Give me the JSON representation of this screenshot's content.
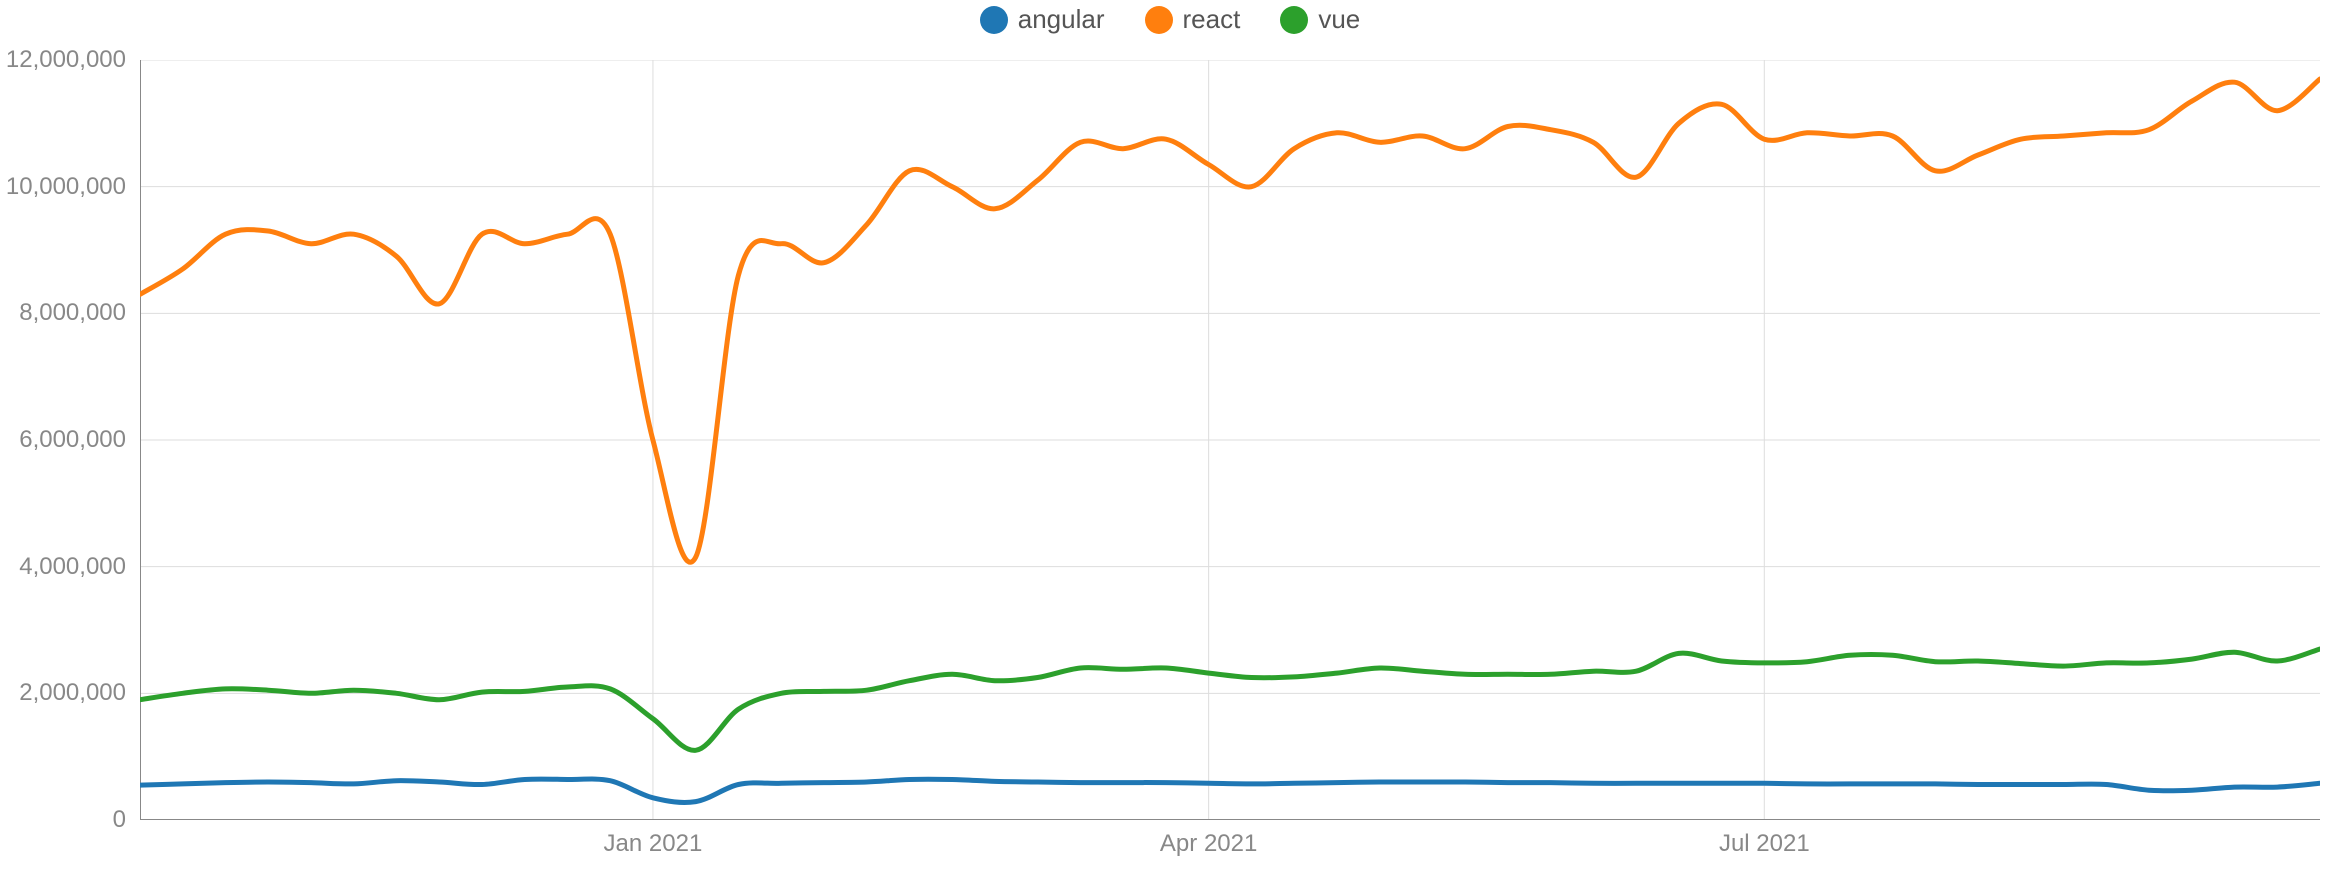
{
  "legend": {
    "items": [
      {
        "name": "angular",
        "label": "angular",
        "color": "#1f77b4"
      },
      {
        "name": "react",
        "label": "react",
        "color": "#ff7f0e"
      },
      {
        "name": "vue",
        "label": "vue",
        "color": "#2ca02c"
      }
    ]
  },
  "chart_data": {
    "type": "line",
    "title": "",
    "xlabel": "",
    "ylabel": "",
    "ylim": [
      0,
      12000000
    ],
    "y_ticks": [
      0,
      2000000,
      4000000,
      6000000,
      8000000,
      10000000,
      12000000
    ],
    "y_tick_labels": [
      "0",
      "2,000,000",
      "4,000,000",
      "6,000,000",
      "8,000,000",
      "10,000,000",
      "12,000,000"
    ],
    "xlim": [
      0,
      51
    ],
    "x_ticks": [
      12,
      25,
      38
    ],
    "x_tick_labels": [
      "Jan 2021",
      "Apr 2021",
      "Jul 2021"
    ],
    "x": [
      0,
      1,
      2,
      3,
      4,
      5,
      6,
      7,
      8,
      9,
      10,
      11,
      12,
      13,
      14,
      15,
      16,
      17,
      18,
      19,
      20,
      21,
      22,
      23,
      24,
      25,
      26,
      27,
      28,
      29,
      30,
      31,
      32,
      33,
      34,
      35,
      36,
      37,
      38,
      39,
      40,
      41,
      42,
      43,
      44,
      45,
      46,
      47,
      48,
      49,
      50,
      51
    ],
    "series": [
      {
        "name": "angular",
        "color": "#1f77b4",
        "values": [
          550000,
          570000,
          590000,
          600000,
          590000,
          570000,
          620000,
          600000,
          560000,
          640000,
          640000,
          620000,
          350000,
          290000,
          560000,
          580000,
          590000,
          600000,
          640000,
          640000,
          610000,
          600000,
          590000,
          590000,
          590000,
          580000,
          570000,
          580000,
          590000,
          600000,
          600000,
          600000,
          590000,
          590000,
          580000,
          580000,
          580000,
          580000,
          580000,
          570000,
          570000,
          570000,
          570000,
          560000,
          560000,
          560000,
          560000,
          470000,
          470000,
          520000,
          520000,
          580000
        ]
      },
      {
        "name": "react",
        "color": "#ff7f0e",
        "values": [
          8300000,
          8700000,
          9250000,
          9300000,
          9100000,
          9250000,
          8900000,
          8150000,
          9250000,
          9100000,
          9250000,
          9250000,
          6000000,
          4150000,
          8600000,
          9100000,
          8800000,
          9400000,
          10250000,
          10000000,
          9650000,
          10100000,
          10700000,
          10600000,
          10750000,
          10350000,
          10000000,
          10600000,
          10850000,
          10700000,
          10800000,
          10600000,
          10950000,
          10900000,
          10700000,
          10150000,
          11000000,
          11300000,
          10750000,
          10850000,
          10800000,
          10800000,
          10250000,
          10500000,
          10750000,
          10800000,
          10850000,
          10900000,
          11350000,
          11650000,
          11200000,
          11700000
        ]
      },
      {
        "name": "vue",
        "color": "#2ca02c",
        "values": [
          1900000,
          2000000,
          2070000,
          2050000,
          2000000,
          2050000,
          2000000,
          1900000,
          2020000,
          2030000,
          2100000,
          2070000,
          1600000,
          1100000,
          1750000,
          2000000,
          2030000,
          2050000,
          2200000,
          2300000,
          2200000,
          2250000,
          2400000,
          2380000,
          2400000,
          2320000,
          2250000,
          2260000,
          2320000,
          2400000,
          2350000,
          2300000,
          2300000,
          2300000,
          2350000,
          2350000,
          2630000,
          2510000,
          2480000,
          2500000,
          2600000,
          2600000,
          2500000,
          2510000,
          2470000,
          2430000,
          2480000,
          2480000,
          2540000,
          2650000,
          2510000,
          2700000
        ]
      }
    ]
  }
}
